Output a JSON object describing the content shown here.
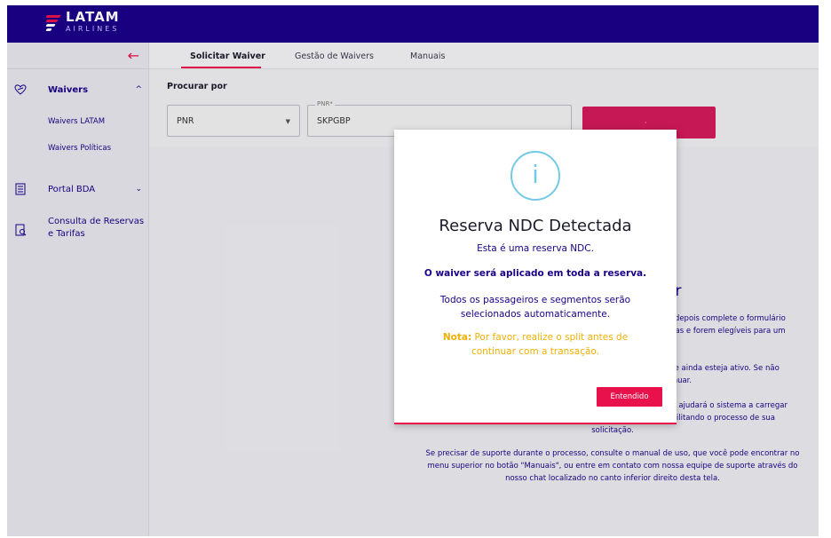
{
  "brand": {
    "name": "LATAM",
    "sub": "AIRLINES",
    "colors": {
      "navy": "#1b0088",
      "pink": "#e8114b",
      "teal": "#74c9e6",
      "note": "#f0b000"
    }
  },
  "sidebar": {
    "back_icon": "arrow-left-icon",
    "items": [
      {
        "label": "Waivers",
        "icon": "heart-plane-icon",
        "expanded": true,
        "children": [
          "Waivers LATAM",
          "Waivers Políticas"
        ]
      },
      {
        "label": "Portal BDA",
        "icon": "document-list-icon",
        "expanded": false
      },
      {
        "label_line1": "Consulta de Reservas",
        "label_line2": "e Tarifas",
        "icon": "document-search-icon"
      }
    ]
  },
  "tabs": [
    {
      "label": "Solicitar Waiver",
      "active": true
    },
    {
      "label": "Gestão de Waivers",
      "active": false
    },
    {
      "label": "Manuais",
      "active": false
    }
  ],
  "search": {
    "title": "Procurar por",
    "select_value": "PNR",
    "pnr_label": "PNR*",
    "pnr_value": "SKPGBP"
  },
  "background_text": {
    "title_fragment": "ver",
    "lines": [
      "e depois complete o formulário",
      "etas e forem elegíveis para um",
      ".",
      "ele ainda esteja ativo. Se não",
      "tinuar.",
      "so ajudará o sistema a carregar",
      "acilitando o processo de sua"
    ],
    "solicitacao": "solicitação.",
    "support_lines": [
      "Se precisar de suporte durante o processo, consulte o manual de uso, que você pode encontrar no",
      "menu superior no botão \"Manuais\", ou entre em contato com nossa equipe de suporte através do",
      "nosso chat localizado no canto inferior direito desta tela."
    ]
  },
  "modal": {
    "icon": "info-icon",
    "icon_glyph": "i",
    "title": "Reserva NDC Detectada",
    "subtitle": "Esta é uma reserva NDC.",
    "bold_line": "O waiver será aplicado em toda a reserva.",
    "text_line1": "Todos os passageiros e segmentos serão",
    "text_line2": "selecionados automaticamente.",
    "note_label": "Nota:",
    "note_line1": " Por favor, realize o split antes de",
    "note_line2": "continuar com a transação.",
    "button_label": "Entendido"
  }
}
